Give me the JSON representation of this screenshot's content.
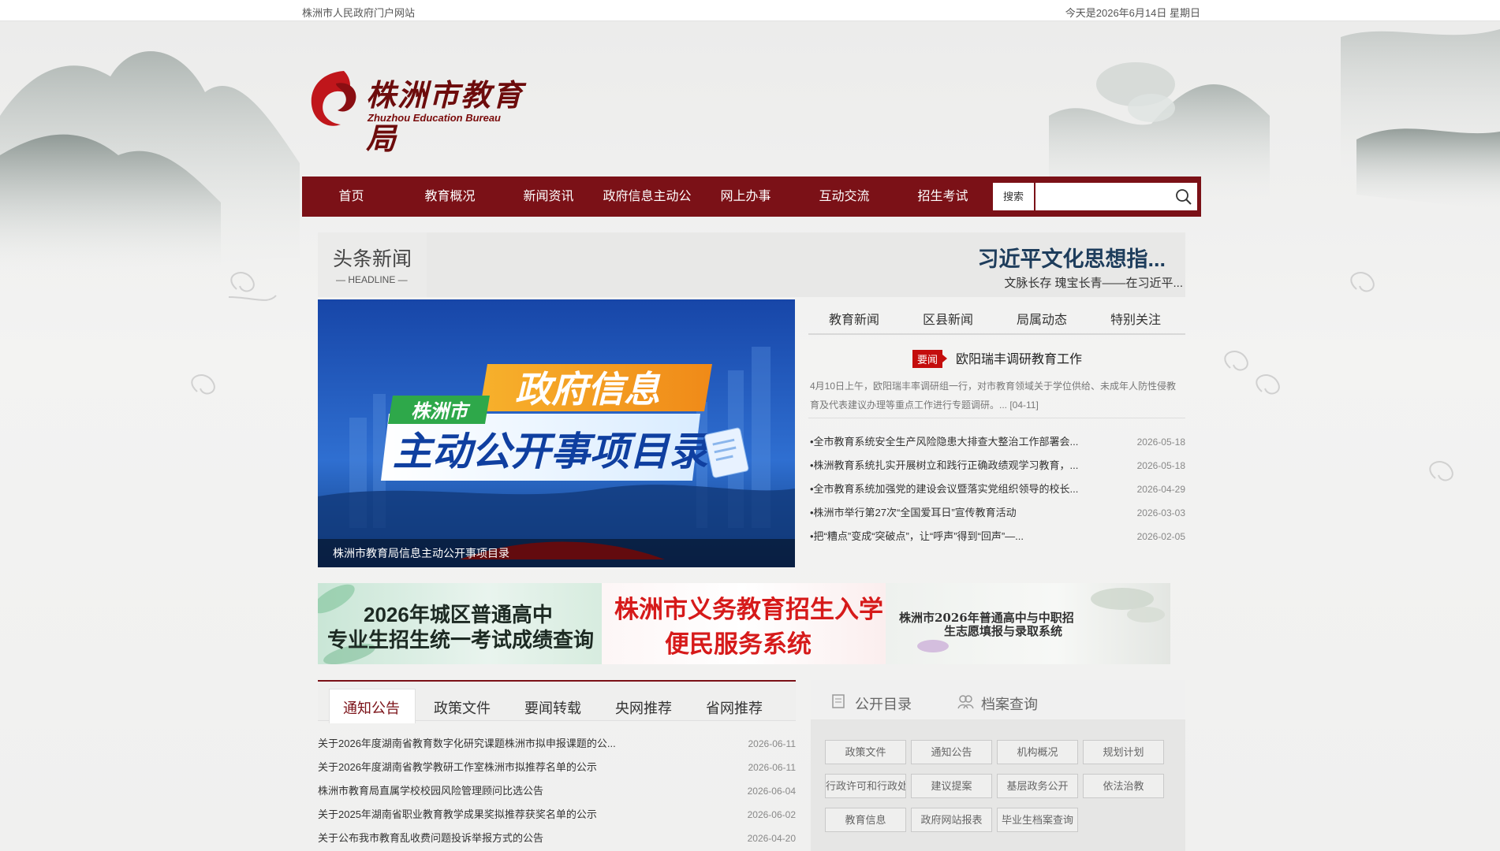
{
  "topbar": {
    "site_name": "株洲市人民政府门户网站",
    "date_text": "今天是2026年6月14日 星期日"
  },
  "logo": {
    "name_cn": "株洲市教育局",
    "name_en": "Zhuzhou Education Bureau"
  },
  "colors": {
    "brand": "#7b1117",
    "badge": "#c40d0d",
    "headline_title": "#1e3d5c"
  },
  "nav": {
    "items": [
      "首页",
      "教育概况",
      "新闻资讯",
      "政府信息主动公",
      "网上办事",
      "互动交流",
      "招生考试"
    ],
    "search_label": "搜索",
    "search_value": "",
    "search_icon": "search-icon"
  },
  "headline": {
    "label": "头条新闻",
    "sublabel": "— HEADLINE —",
    "title": "习近平文化思想指...",
    "subtitle": "文脉长存 瑰宝长青——在习近平..."
  },
  "banner": {
    "tag": "株洲市",
    "line1": "政府信息",
    "line2": "主动公开事项目录",
    "caption": "株洲市教育局信息主动公开事项目录"
  },
  "news": {
    "tabs": [
      "教育新闻",
      "区县新闻",
      "局属动态",
      "特别关注"
    ],
    "feature": {
      "badge": "要闻",
      "title": "欧阳瑞丰调研教育工作",
      "summary": "4月10日上午，欧阳瑞丰率调研组一行，对市教育领域关于学位供给、未成年人防性侵教育及代表建议办理等重点工作进行专题调研。... [04-11]"
    },
    "items": [
      {
        "title": "•全市教育系统安全生产风险隐患大排查大整治工作部署会...",
        "date": "2026-05-18"
      },
      {
        "title": "•株洲教育系统扎实开展树立和践行正确政绩观学习教育，...",
        "date": "2026-05-18"
      },
      {
        "title": "•全市教育系统加强党的建设会议暨落实党组织领导的校长...",
        "date": "2026-04-29"
      },
      {
        "title": "•株洲市举行第27次“全国爱耳日”宣传教育活动",
        "date": "2026-03-03"
      },
      {
        "title": "•把“糟点”变成“突破点”，让“呼声”得到“回声”—...",
        "date": "2026-02-05"
      }
    ]
  },
  "promos": [
    {
      "line1": "2026年城区普通高中",
      "line2": "专业生招生统一考试成绩查询"
    },
    {
      "line1": "株洲市义务教育招生入学",
      "line2": "便民服务系统"
    },
    {
      "line1": "株洲市2026年普通高中与中职招",
      "line2": "生志愿填报与录取系统"
    }
  ],
  "notices": {
    "tabs": [
      "通知公告",
      "政策文件",
      "要闻转载",
      "央网推荐",
      "省网推荐"
    ],
    "items": [
      {
        "title": "关于2026年度湖南省教育数字化研究课题株洲市拟申报课题的公...",
        "date": "2026-06-11"
      },
      {
        "title": "关于2026年度湖南省教学教研工作室株洲市拟推荐名单的公示",
        "date": "2026-06-11"
      },
      {
        "title": "株洲市教育局直属学校校园风险管理顾问比选公告",
        "date": "2026-06-04"
      },
      {
        "title": "关于2025年湖南省职业教育教学成果奖拟推荐获奖名单的公示",
        "date": "2026-06-02"
      },
      {
        "title": "关于公布我市教育乱收费问题投诉举报方式的公告",
        "date": "2026-04-20"
      }
    ]
  },
  "catalog": {
    "tabs": [
      "公开目录",
      "档案查询"
    ],
    "buttons": [
      "政策文件",
      "通知公告",
      "机构概况",
      "规划计划",
      "行政许可和行政处",
      "建议提案",
      "基层政务公开",
      "依法治教",
      "教育信息",
      "政府网站报表",
      "毕业生档案查询"
    ]
  }
}
